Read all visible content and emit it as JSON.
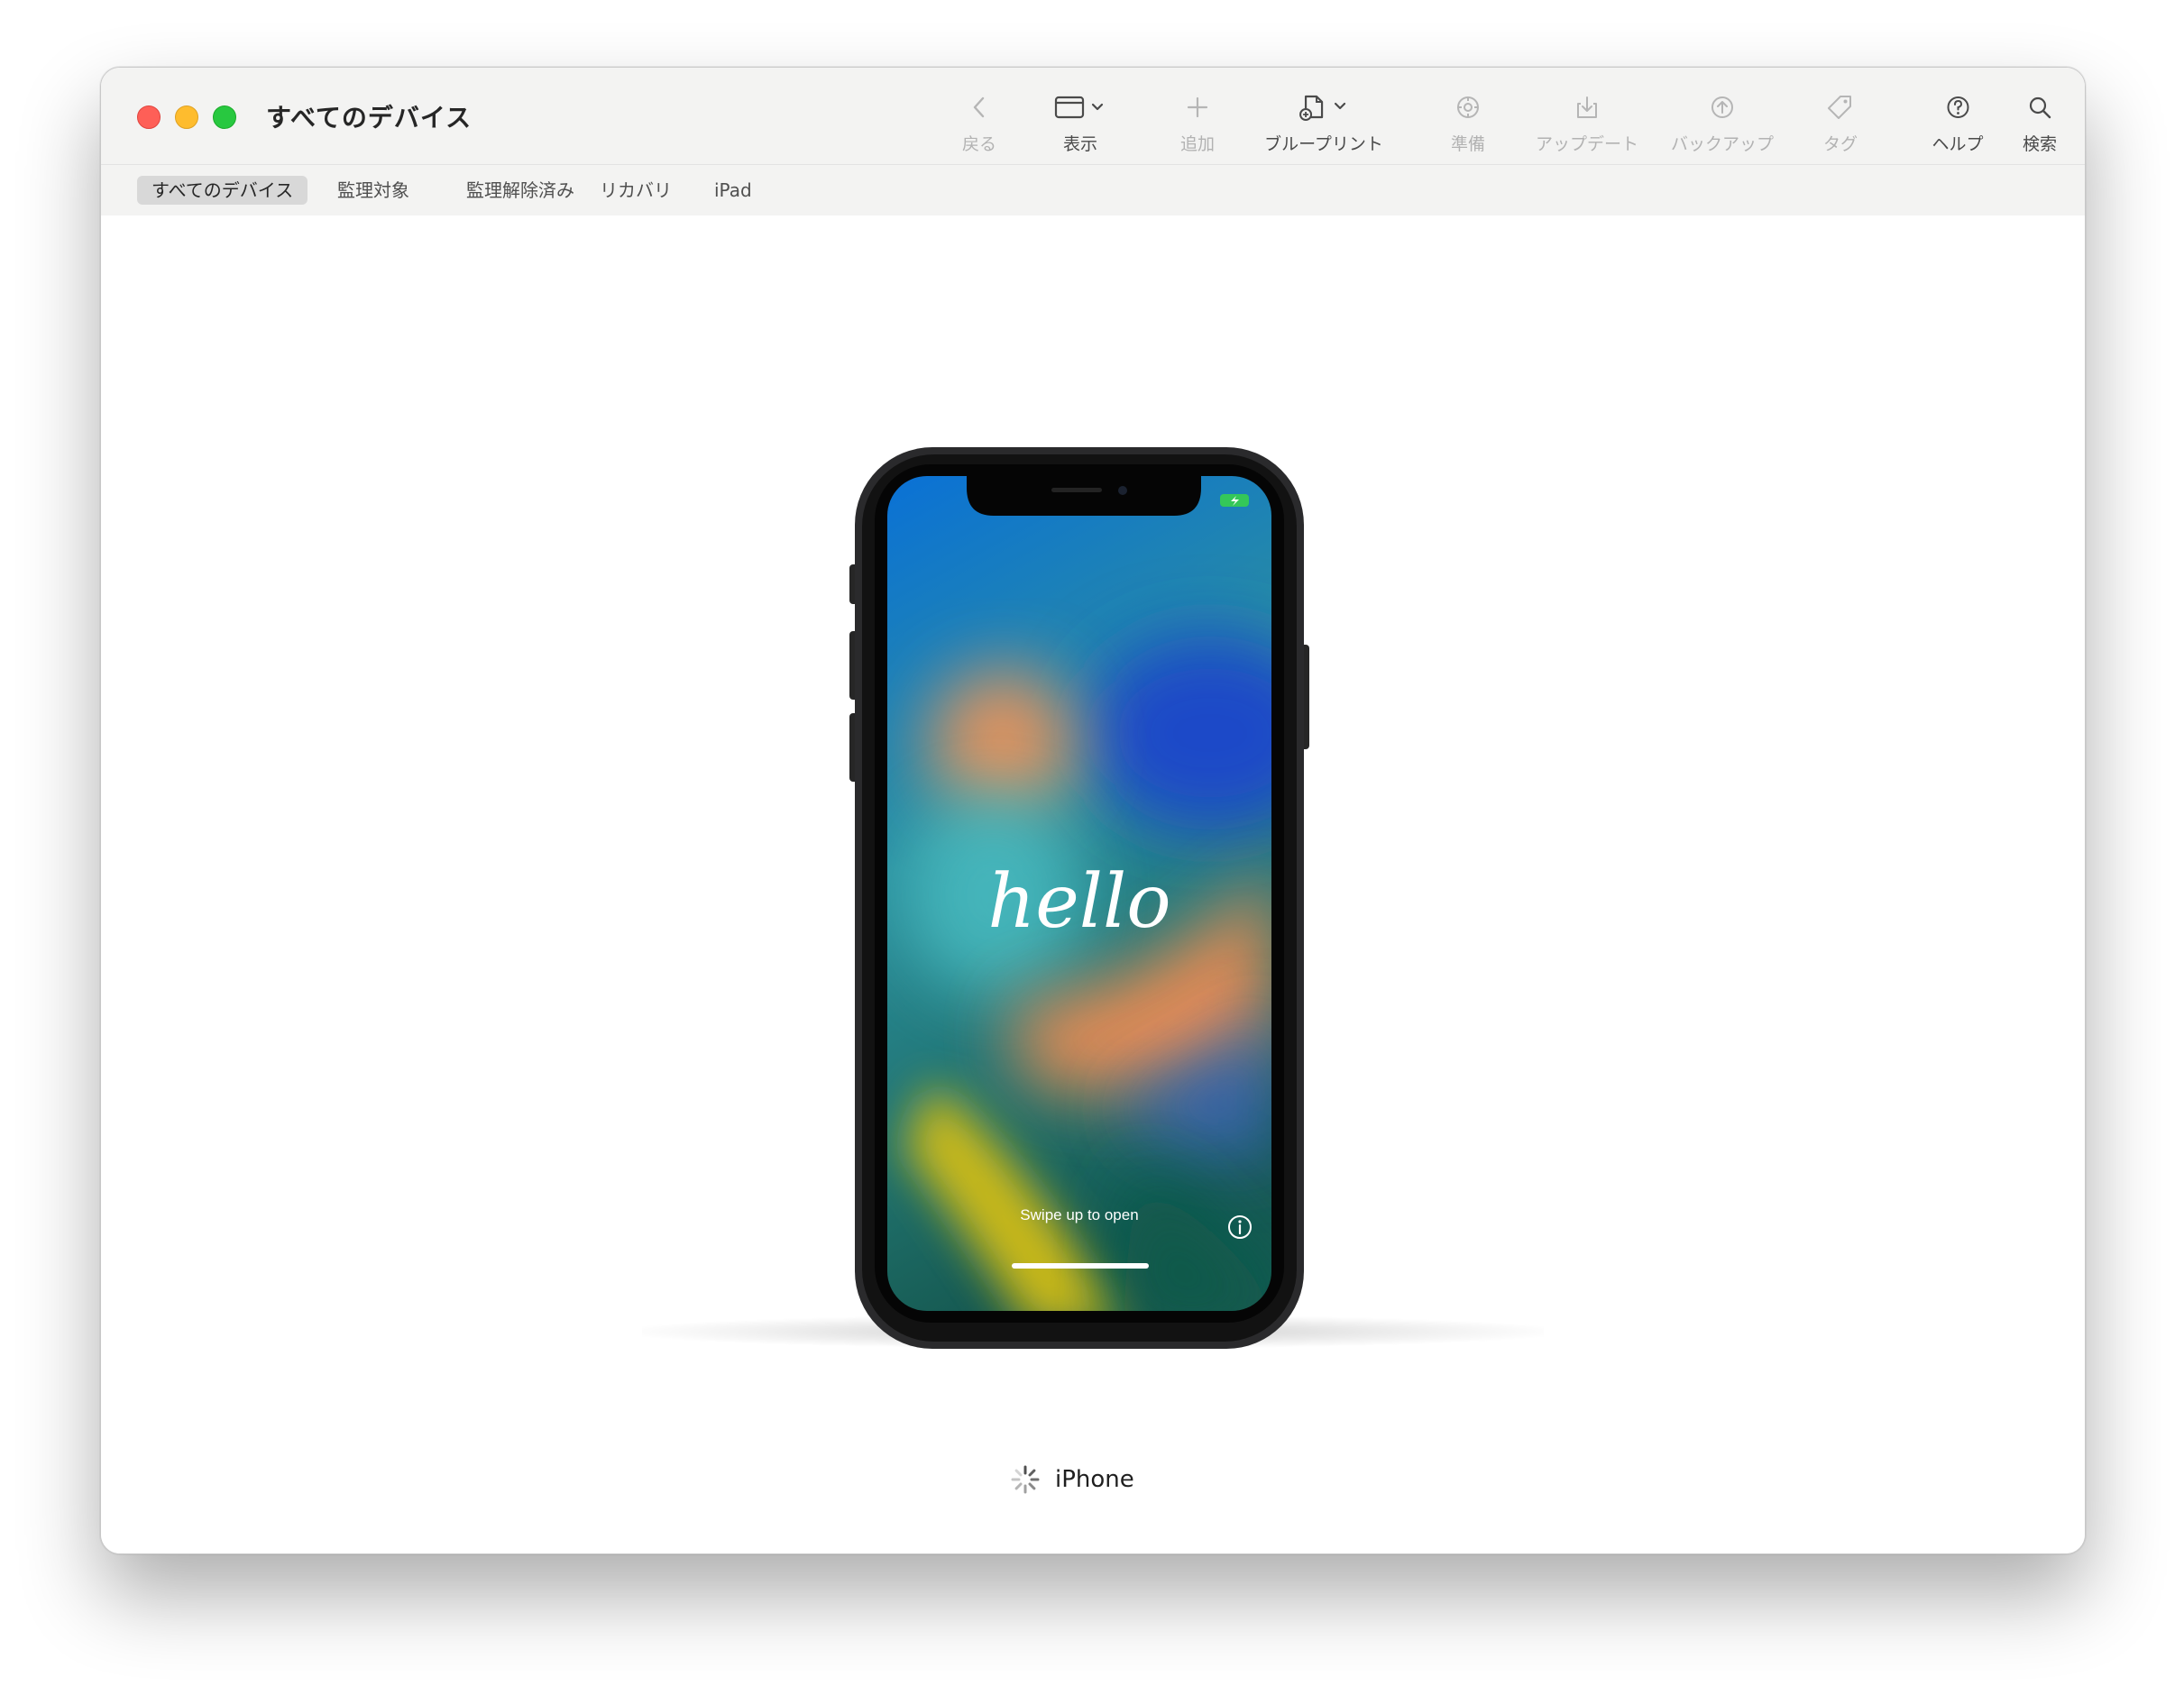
{
  "window": {
    "title": "すべてのデバイス"
  },
  "toolbar": {
    "back_label": "戻る",
    "view_label": "表示",
    "add_label": "追加",
    "blueprint_label": "ブループリント",
    "prepare_label": "準備",
    "update_label": "アップデート",
    "backup_label": "バックアップ",
    "tag_label": "タグ",
    "help_label": "ヘルプ",
    "search_label": "検索"
  },
  "filters": [
    {
      "label": "すべてのデバイス",
      "selected": true
    },
    {
      "label": "監理対象",
      "selected": false
    },
    {
      "label": "監理解除済み",
      "selected": false
    },
    {
      "label": "リカバリ",
      "selected": false
    },
    {
      "label": "iPad",
      "selected": false
    }
  ],
  "device": {
    "name": "iPhone",
    "screen_greeting": "hello",
    "screen_hint": "Swipe up to open",
    "status_icon": "spinner-icon"
  },
  "colors": {
    "close": "#fe5f57",
    "minimize": "#febc2e",
    "maximize": "#28c840",
    "selected_filter_bg": "#d8d8d8",
    "battery": "#34c759"
  }
}
